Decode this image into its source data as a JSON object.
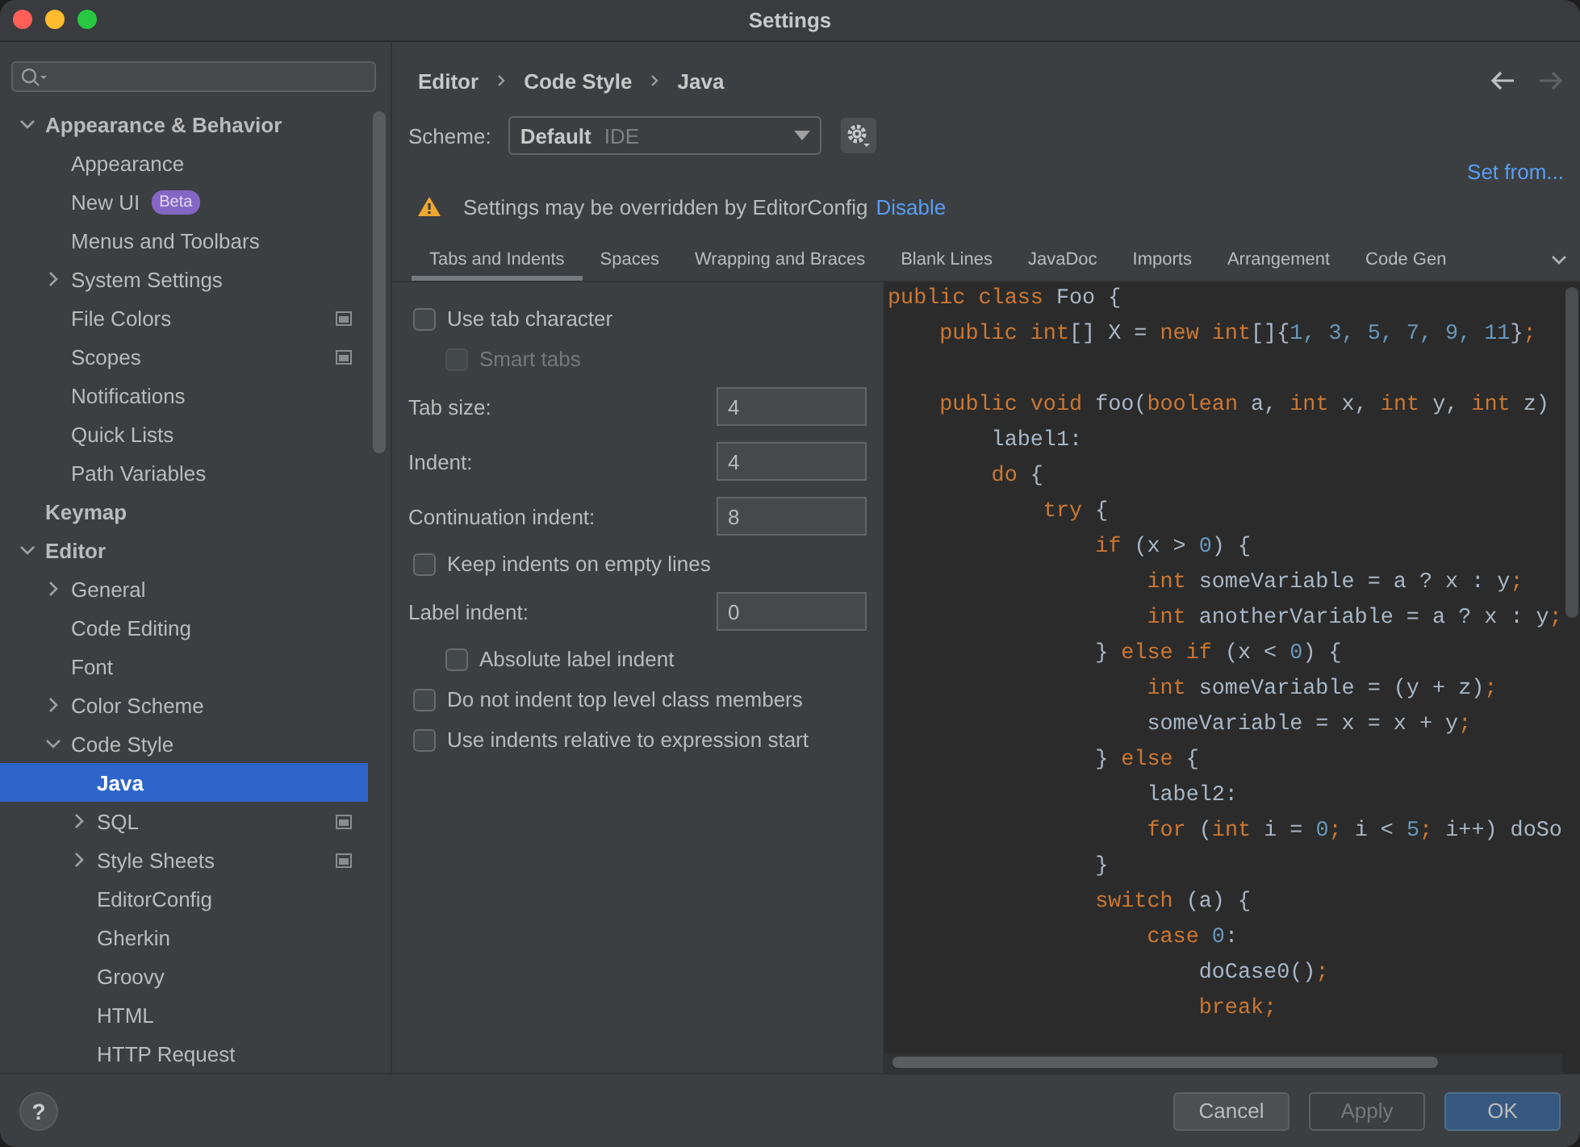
{
  "window": {
    "title": "Settings"
  },
  "sidebar": {
    "items": [
      {
        "label": "Appearance & Behavior",
        "expanded": true,
        "selected": false,
        "children": [
          {
            "label": "Appearance",
            "selected": false
          },
          {
            "label": "New UI",
            "selected": false,
            "badge": "Beta"
          },
          {
            "label": "Menus and Toolbars",
            "selected": false
          },
          {
            "label": "System Settings",
            "expanded": false,
            "selected": false
          },
          {
            "label": "File Colors",
            "selected": false,
            "project_level": true
          },
          {
            "label": "Scopes",
            "selected": false,
            "project_level": true
          },
          {
            "label": "Notifications",
            "selected": false
          },
          {
            "label": "Quick Lists",
            "selected": false
          },
          {
            "label": "Path Variables",
            "selected": false
          }
        ]
      },
      {
        "label": "Keymap",
        "selected": false
      },
      {
        "label": "Editor",
        "expanded": true,
        "selected": false,
        "children": [
          {
            "label": "General",
            "expanded": false,
            "selected": false
          },
          {
            "label": "Code Editing",
            "selected": false
          },
          {
            "label": "Font",
            "selected": false
          },
          {
            "label": "Color Scheme",
            "expanded": false,
            "selected": false
          },
          {
            "label": "Code Style",
            "expanded": true,
            "selected": false,
            "children": [
              {
                "label": "Java",
                "selected": true
              },
              {
                "label": "SQL",
                "expanded": false,
                "selected": false,
                "project_level": true
              },
              {
                "label": "Style Sheets",
                "expanded": false,
                "selected": false,
                "project_level": true
              },
              {
                "label": "EditorConfig",
                "selected": false
              },
              {
                "label": "Gherkin",
                "selected": false
              },
              {
                "label": "Groovy",
                "selected": false
              },
              {
                "label": "HTML",
                "selected": false
              },
              {
                "label": "HTTP Request",
                "selected": false
              }
            ]
          }
        ]
      }
    ]
  },
  "breadcrumb": [
    "Editor",
    "Code Style",
    "Java"
  ],
  "navigation": [
    {
      "kind": "back",
      "disabled": false
    },
    {
      "kind": "forward",
      "disabled": true
    }
  ],
  "scheme": {
    "label": "Scheme:",
    "value": "Default",
    "qualifier": "IDE"
  },
  "set_from": "Set from...",
  "warning": {
    "text": "Settings may be overridden by EditorConfig",
    "link": "Disable"
  },
  "tabs": [
    {
      "label": "Tabs and Indents",
      "selected": true
    },
    {
      "label": "Spaces",
      "selected": false
    },
    {
      "label": "Wrapping and Braces",
      "selected": false
    },
    {
      "label": "Blank Lines",
      "selected": false
    },
    {
      "label": "JavaDoc",
      "selected": false
    },
    {
      "label": "Imports",
      "selected": false
    },
    {
      "label": "Arrangement",
      "selected": false
    },
    {
      "label": "Code Gen",
      "selected": false
    }
  ],
  "options": [
    {
      "kind": "checkbox",
      "label": "Use tab character",
      "checked": false,
      "disabled": false,
      "children": [
        {
          "kind": "checkbox",
          "label": "Smart tabs",
          "checked": false,
          "disabled": true
        }
      ]
    },
    {
      "kind": "field",
      "label": "Tab size:",
      "value": "4"
    },
    {
      "kind": "field",
      "label": "Indent:",
      "value": "4"
    },
    {
      "kind": "field",
      "label": "Continuation indent:",
      "value": "8"
    },
    {
      "kind": "checkbox",
      "label": "Keep indents on empty lines",
      "checked": false,
      "disabled": false
    },
    {
      "kind": "field",
      "label": "Label indent:",
      "value": "0",
      "children": [
        {
          "kind": "checkbox",
          "label": "Absolute label indent",
          "checked": false,
          "disabled": false
        }
      ]
    },
    {
      "kind": "checkbox",
      "label": "Do not indent top level class members",
      "checked": false,
      "disabled": false
    },
    {
      "kind": "checkbox",
      "label": "Use indents relative to expression start",
      "checked": false,
      "disabled": false
    }
  ],
  "code_preview": [
    {
      "kind": "code",
      "tokens": [
        {
          "kind": "keyword",
          "text": "public class "
        },
        {
          "kind": "plain",
          "text": "Foo {"
        }
      ]
    },
    {
      "kind": "code",
      "tokens": [
        {
          "kind": "keyword",
          "text": "    public int"
        },
        {
          "kind": "plain",
          "text": "[] X = "
        },
        {
          "kind": "keyword",
          "text": "new int"
        },
        {
          "kind": "plain",
          "text": "[]{"
        },
        {
          "kind": "number",
          "text": "1, 3, 5, 7, 9, 11"
        },
        {
          "kind": "plain",
          "text": "}"
        },
        {
          "kind": "keyword",
          "text": ";"
        }
      ]
    },
    {
      "kind": "blank"
    },
    {
      "kind": "code",
      "tokens": [
        {
          "kind": "keyword",
          "text": "    public void "
        },
        {
          "kind": "plain",
          "text": "foo("
        },
        {
          "kind": "keyword",
          "text": "boolean "
        },
        {
          "kind": "plain",
          "text": "a, "
        },
        {
          "kind": "keyword",
          "text": "int "
        },
        {
          "kind": "plain",
          "text": "x, "
        },
        {
          "kind": "keyword",
          "text": "int "
        },
        {
          "kind": "plain",
          "text": "y, "
        },
        {
          "kind": "keyword",
          "text": "int "
        },
        {
          "kind": "plain",
          "text": "z)"
        }
      ]
    },
    {
      "kind": "code",
      "tokens": [
        {
          "kind": "plain",
          "text": "        label1:"
        }
      ]
    },
    {
      "kind": "code",
      "tokens": [
        {
          "kind": "keyword",
          "text": "        do "
        },
        {
          "kind": "plain",
          "text": "{"
        }
      ]
    },
    {
      "kind": "code",
      "tokens": [
        {
          "kind": "keyword",
          "text": "            try "
        },
        {
          "kind": "plain",
          "text": "{"
        }
      ]
    },
    {
      "kind": "code",
      "tokens": [
        {
          "kind": "keyword",
          "text": "                if "
        },
        {
          "kind": "plain",
          "text": "(x > "
        },
        {
          "kind": "number",
          "text": "0"
        },
        {
          "kind": "plain",
          "text": ") {"
        }
      ]
    },
    {
      "kind": "code",
      "tokens": [
        {
          "kind": "keyword",
          "text": "                    int "
        },
        {
          "kind": "plain",
          "text": "someVariable = a ? x : y"
        },
        {
          "kind": "keyword",
          "text": ";"
        }
      ]
    },
    {
      "kind": "code",
      "tokens": [
        {
          "kind": "keyword",
          "text": "                    int "
        },
        {
          "kind": "plain",
          "text": "anotherVariable = a ? x : y"
        },
        {
          "kind": "keyword",
          "text": ";"
        }
      ]
    },
    {
      "kind": "code",
      "tokens": [
        {
          "kind": "plain",
          "text": "                } "
        },
        {
          "kind": "keyword",
          "text": "else if "
        },
        {
          "kind": "plain",
          "text": "(x < "
        },
        {
          "kind": "number",
          "text": "0"
        },
        {
          "kind": "plain",
          "text": ") {"
        }
      ]
    },
    {
      "kind": "code",
      "tokens": [
        {
          "kind": "keyword",
          "text": "                    int "
        },
        {
          "kind": "plain",
          "text": "someVariable = (y + z)"
        },
        {
          "kind": "keyword",
          "text": ";"
        }
      ]
    },
    {
      "kind": "code",
      "tokens": [
        {
          "kind": "plain",
          "text": "                    someVariable = x = x + y"
        },
        {
          "kind": "keyword",
          "text": ";"
        }
      ]
    },
    {
      "kind": "code",
      "tokens": [
        {
          "kind": "plain",
          "text": "                } "
        },
        {
          "kind": "keyword",
          "text": "else "
        },
        {
          "kind": "plain",
          "text": "{"
        }
      ]
    },
    {
      "kind": "code",
      "tokens": [
        {
          "kind": "plain",
          "text": "                    label2:"
        }
      ]
    },
    {
      "kind": "code",
      "tokens": [
        {
          "kind": "keyword",
          "text": "                    for "
        },
        {
          "kind": "plain",
          "text": "("
        },
        {
          "kind": "keyword",
          "text": "int "
        },
        {
          "kind": "plain",
          "text": "i = "
        },
        {
          "kind": "number",
          "text": "0"
        },
        {
          "kind": "keyword",
          "text": "; "
        },
        {
          "kind": "plain",
          "text": "i < "
        },
        {
          "kind": "number",
          "text": "5"
        },
        {
          "kind": "keyword",
          "text": "; "
        },
        {
          "kind": "plain",
          "text": "i++) doSo"
        }
      ]
    },
    {
      "kind": "code",
      "tokens": [
        {
          "kind": "plain",
          "text": "                }"
        }
      ]
    },
    {
      "kind": "code",
      "tokens": [
        {
          "kind": "keyword",
          "text": "                switch "
        },
        {
          "kind": "plain",
          "text": "(a) {"
        }
      ]
    },
    {
      "kind": "code",
      "tokens": [
        {
          "kind": "keyword",
          "text": "                    case "
        },
        {
          "kind": "number",
          "text": "0"
        },
        {
          "kind": "plain",
          "text": ":"
        }
      ]
    },
    {
      "kind": "code",
      "tokens": [
        {
          "kind": "plain",
          "text": "                        doCase0()"
        },
        {
          "kind": "keyword",
          "text": ";"
        }
      ]
    },
    {
      "kind": "code",
      "tokens": [
        {
          "kind": "keyword",
          "text": "                        break;"
        }
      ]
    }
  ],
  "buttons": [
    {
      "label": "Cancel",
      "kind": "default",
      "disabled": false
    },
    {
      "label": "Apply",
      "kind": "default",
      "disabled": true
    },
    {
      "label": "OK",
      "kind": "primary",
      "disabled": false
    }
  ],
  "help": "?"
}
